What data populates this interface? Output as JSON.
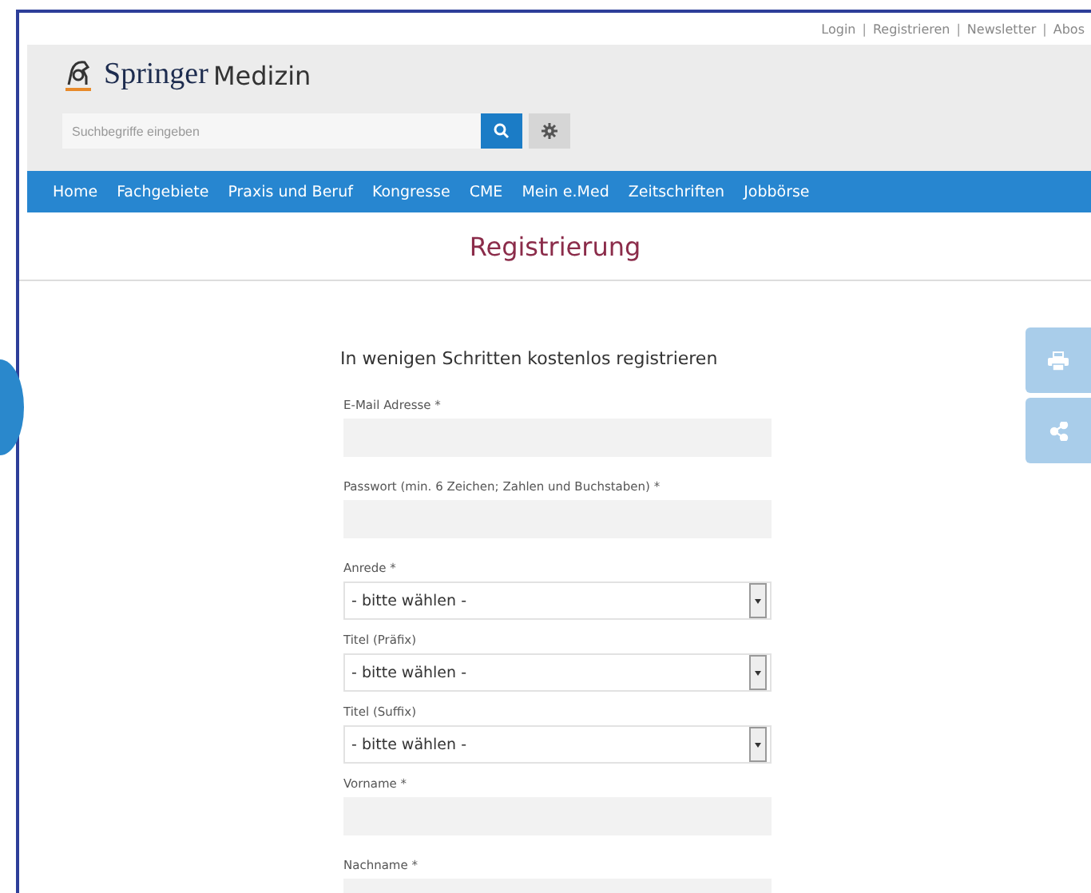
{
  "top_links": {
    "separator": "|",
    "items": [
      {
        "label": "Login"
      },
      {
        "label": "Registrieren"
      },
      {
        "label": "Newsletter"
      },
      {
        "label": "Abos"
      }
    ]
  },
  "logo": {
    "brand": "Springer",
    "product": "Medizin"
  },
  "search": {
    "placeholder": "Suchbegriffe eingeben"
  },
  "nav": [
    {
      "label": "Home"
    },
    {
      "label": "Fachgebiete"
    },
    {
      "label": "Praxis und Beruf"
    },
    {
      "label": "Kongresse"
    },
    {
      "label": "CME"
    },
    {
      "label": "Mein e.Med"
    },
    {
      "label": "Zeitschriften"
    },
    {
      "label": "Jobbörse"
    }
  ],
  "page_title": "Registrierung",
  "form": {
    "heading": "In wenigen Schritten kostenlos registrieren",
    "fields": [
      {
        "kind": "text",
        "label": "E-Mail Adresse *"
      },
      {
        "kind": "text",
        "label": "Passwort (min. 6 Zeichen; Zahlen und Buchstaben) *"
      },
      {
        "kind": "select",
        "label": "Anrede *",
        "value": "- bitte wählen -"
      },
      {
        "kind": "select",
        "label": "Titel (Präfix)",
        "value": "- bitte wählen -"
      },
      {
        "kind": "select",
        "label": "Titel (Suffix)",
        "value": "- bitte wählen -"
      },
      {
        "kind": "text",
        "label": "Vorname *"
      },
      {
        "kind": "text",
        "label": "Nachname *"
      }
    ]
  },
  "side_actions": [
    {
      "kind": "print"
    },
    {
      "kind": "share"
    }
  ]
}
